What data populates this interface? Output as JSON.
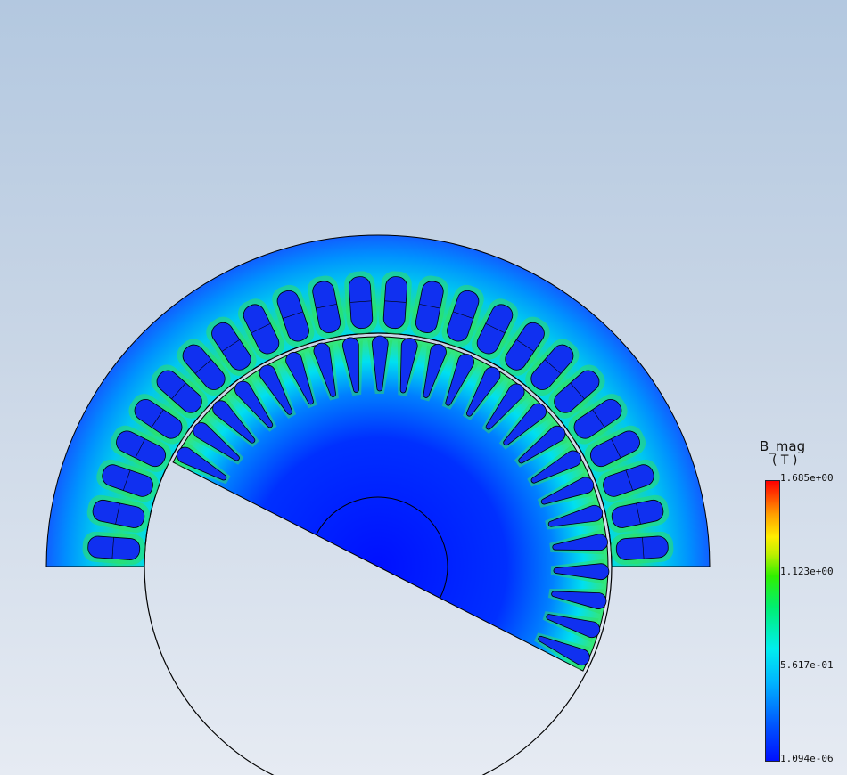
{
  "legend": {
    "title": "B_mag",
    "unit": "( T )",
    "ticks": [
      "1.685e+00",
      "1.123e+00",
      "5.617e-01",
      "1.094e-06"
    ]
  },
  "colors": {
    "background_top": "#b3c8e0",
    "background_bottom": "#e6ebf3",
    "low_field": "#0010ff",
    "mid_field": "#00eeee",
    "high_field": "#ff0000"
  },
  "model": {
    "stator_slots": 24,
    "rotor_slots": 24
  }
}
